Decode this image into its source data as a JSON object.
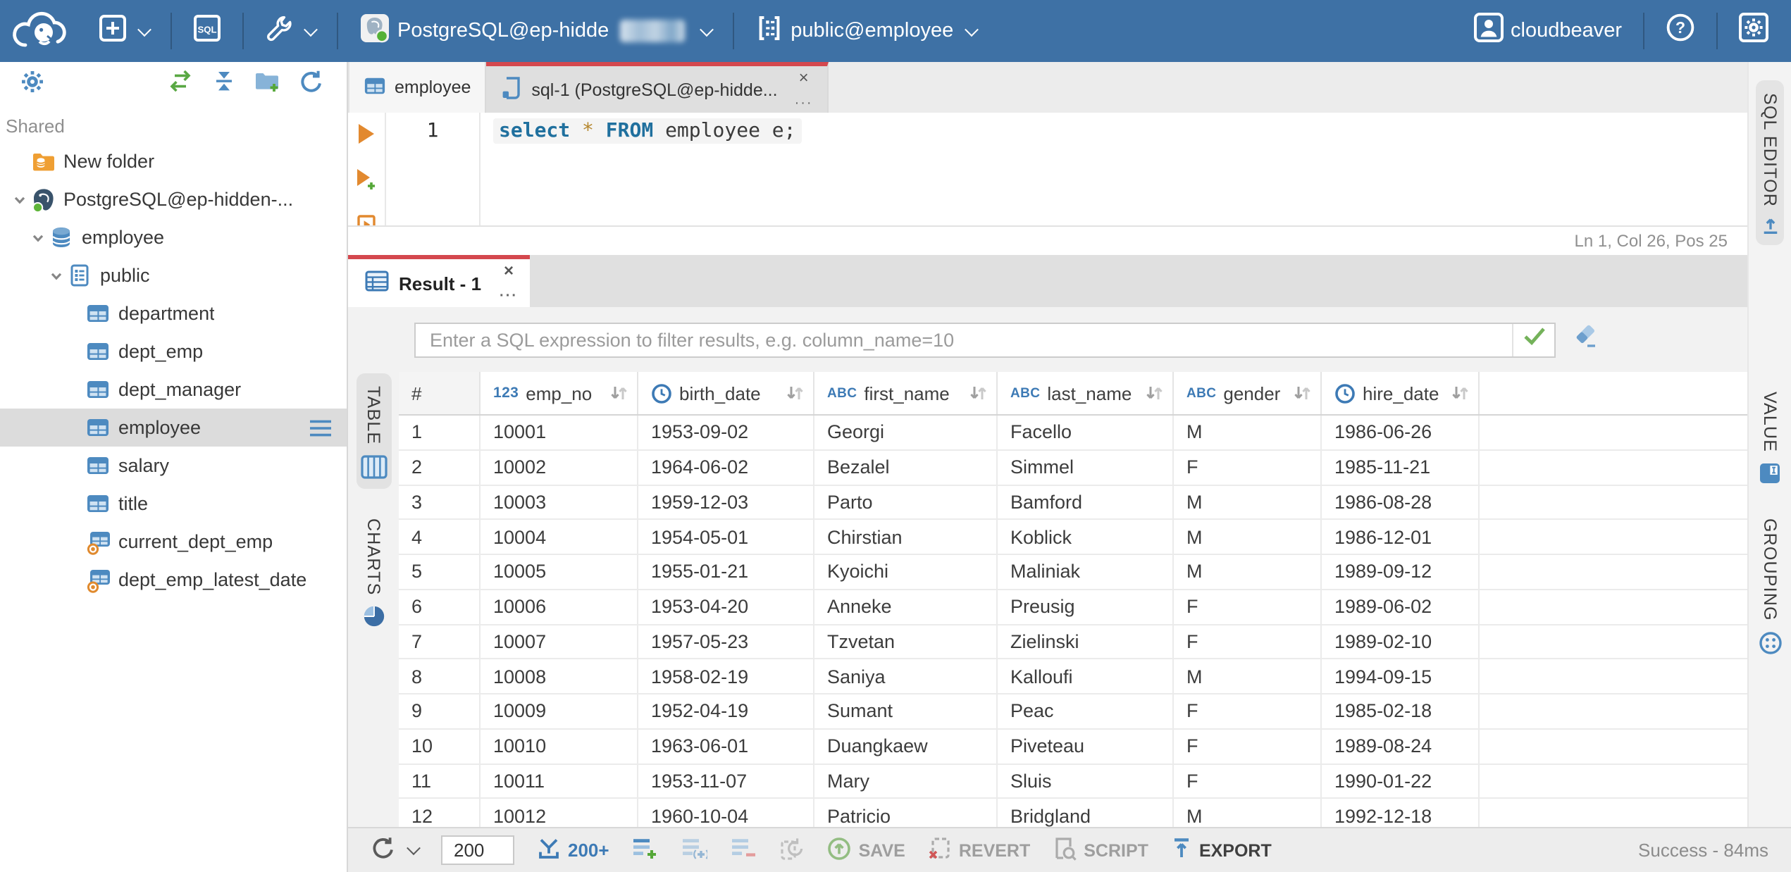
{
  "colors": {
    "topbar_bg": "#3e71a5",
    "accent_blue": "#4d8ac0",
    "active_tab_red": "#d4484e",
    "success_green": "#5fb53a",
    "selected_row_gray": "#dcdcdc"
  },
  "topbar": {
    "sql_button_label": "SQL",
    "connection_label": "PostgreSQL@ep-hidde",
    "schema_label": "public@employee",
    "user_label": "cloudbeaver"
  },
  "sidebar": {
    "section_label": "Shared",
    "tree": [
      {
        "label": "New folder",
        "icon": "folder-database",
        "level": 0,
        "chevron": false,
        "selected": false
      },
      {
        "label": "PostgreSQL@ep-hidden-...",
        "icon": "postgres",
        "level": 0,
        "chevron": true,
        "selected": false
      },
      {
        "label": "employee",
        "icon": "database",
        "level": 1,
        "chevron": true,
        "selected": false
      },
      {
        "label": "public",
        "icon": "schema",
        "level": 2,
        "chevron": true,
        "selected": false
      },
      {
        "label": "department",
        "icon": "table",
        "level": 3,
        "chevron": false,
        "selected": false
      },
      {
        "label": "dept_emp",
        "icon": "table",
        "level": 3,
        "chevron": false,
        "selected": false
      },
      {
        "label": "dept_manager",
        "icon": "table",
        "level": 3,
        "chevron": false,
        "selected": false
      },
      {
        "label": "employee",
        "icon": "table",
        "level": 3,
        "chevron": false,
        "selected": true
      },
      {
        "label": "salary",
        "icon": "table",
        "level": 3,
        "chevron": false,
        "selected": false
      },
      {
        "label": "title",
        "icon": "table",
        "level": 3,
        "chevron": false,
        "selected": false
      },
      {
        "label": "current_dept_emp",
        "icon": "view",
        "level": 3,
        "chevron": false,
        "selected": false
      },
      {
        "label": "dept_emp_latest_date",
        "icon": "view",
        "level": 3,
        "chevron": false,
        "selected": false
      }
    ]
  },
  "editor_tabs": [
    {
      "label": "employee"
    },
    {
      "label": "sql-1 (PostgreSQL@ep-hidde..."
    }
  ],
  "editor": {
    "line_number": "1",
    "code": [
      {
        "text": "select",
        "type": "keyword"
      },
      {
        "text": " ",
        "type": "plain"
      },
      {
        "text": "*",
        "type": "operator"
      },
      {
        "text": " ",
        "type": "plain"
      },
      {
        "text": "FROM",
        "type": "keyword"
      },
      {
        "text": " employee e;",
        "type": "plain"
      }
    ],
    "status": "Ln 1, Col 26, Pos 25",
    "sql_editor_tab": "SQL EDITOR"
  },
  "result": {
    "tab_label": "Result - 1",
    "filter_placeholder": "Enter a SQL expression to filter results, e.g. column_name=10",
    "left_tabs": [
      {
        "label": "TABLE",
        "selected": true
      },
      {
        "label": "CHARTS",
        "selected": false
      }
    ],
    "right_tabs": [
      {
        "label": "VALUE"
      },
      {
        "label": "GROUPING"
      }
    ],
    "grid": {
      "row_header": "#",
      "columns": [
        {
          "name": "emp_no",
          "type": "number"
        },
        {
          "name": "birth_date",
          "type": "date"
        },
        {
          "name": "first_name",
          "type": "string"
        },
        {
          "name": "last_name",
          "type": "string"
        },
        {
          "name": "gender",
          "type": "string"
        },
        {
          "name": "hire_date",
          "type": "date"
        }
      ],
      "rows": [
        [
          "1",
          "10001",
          "1953-09-02",
          "Georgi",
          "Facello",
          "M",
          "1986-06-26"
        ],
        [
          "2",
          "10002",
          "1964-06-02",
          "Bezalel",
          "Simmel",
          "F",
          "1985-11-21"
        ],
        [
          "3",
          "10003",
          "1959-12-03",
          "Parto",
          "Bamford",
          "M",
          "1986-08-28"
        ],
        [
          "4",
          "10004",
          "1954-05-01",
          "Chirstian",
          "Koblick",
          "M",
          "1986-12-01"
        ],
        [
          "5",
          "10005",
          "1955-01-21",
          "Kyoichi",
          "Maliniak",
          "M",
          "1989-09-12"
        ],
        [
          "6",
          "10006",
          "1953-04-20",
          "Anneke",
          "Preusig",
          "F",
          "1989-06-02"
        ],
        [
          "7",
          "10007",
          "1957-05-23",
          "Tzvetan",
          "Zielinski",
          "F",
          "1989-02-10"
        ],
        [
          "8",
          "10008",
          "1958-02-19",
          "Saniya",
          "Kalloufi",
          "M",
          "1994-09-15"
        ],
        [
          "9",
          "10009",
          "1952-04-19",
          "Sumant",
          "Peac",
          "F",
          "1985-02-18"
        ],
        [
          "10",
          "10010",
          "1963-06-01",
          "Duangkaew",
          "Piveteau",
          "F",
          "1989-08-24"
        ],
        [
          "11",
          "10011",
          "1953-11-07",
          "Mary",
          "Sluis",
          "F",
          "1990-01-22"
        ],
        [
          "12",
          "10012",
          "1960-10-04",
          "Patricio",
          "Bridgland",
          "M",
          "1992-12-18"
        ]
      ]
    },
    "toolbar": {
      "row_limit": "200",
      "fetch_label": "200+",
      "save_label": "SAVE",
      "revert_label": "REVERT",
      "script_label": "SCRIPT",
      "export_label": "EXPORT",
      "status": "Success - 84ms"
    }
  }
}
